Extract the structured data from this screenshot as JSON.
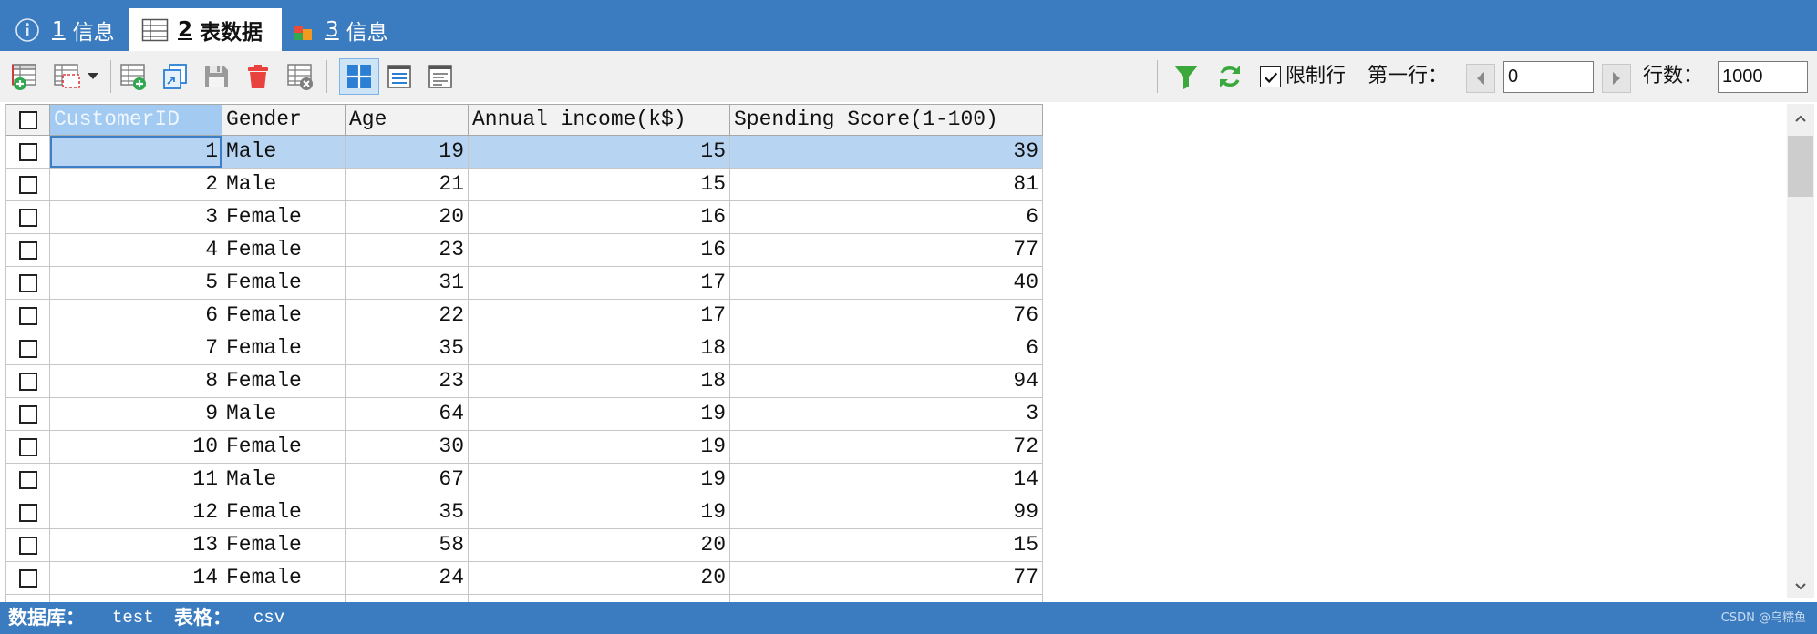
{
  "tabs": [
    {
      "number": "1",
      "label": "信息",
      "icon": "info-icon"
    },
    {
      "number": "2",
      "label": "表数据",
      "icon": "table-icon",
      "selected": true
    },
    {
      "number": "3",
      "label": "信息",
      "icon": "chart-icon"
    }
  ],
  "toolbar": {
    "buttons": [
      {
        "icon": "add-record-icon"
      },
      {
        "icon": "select-records-icon"
      },
      {
        "icon": "insert-record-icon"
      },
      {
        "icon": "duplicate-record-icon"
      },
      {
        "icon": "save-icon"
      },
      {
        "icon": "delete-icon"
      },
      {
        "icon": "cancel-changes-icon"
      },
      {
        "icon": "grid-view-icon",
        "active": true
      },
      {
        "icon": "form-view-icon"
      },
      {
        "icon": "text-view-icon"
      },
      {
        "icon": "filter-icon"
      },
      {
        "icon": "refresh-icon"
      }
    ],
    "limit_rows": {
      "label": "限制行",
      "checked": true
    },
    "first_row": {
      "label": "第一行：",
      "value": "0"
    },
    "row_count": {
      "label": "行数：",
      "value": "1000"
    }
  },
  "grid": {
    "columns": [
      "CustomerID",
      "Gender",
      "Age",
      "Annual income(k$)",
      "Spending Score(1-100)"
    ],
    "rows": [
      [
        1,
        "Male",
        19,
        15,
        39
      ],
      [
        2,
        "Male",
        21,
        15,
        81
      ],
      [
        3,
        "Female",
        20,
        16,
        6
      ],
      [
        4,
        "Female",
        23,
        16,
        77
      ],
      [
        5,
        "Female",
        31,
        17,
        40
      ],
      [
        6,
        "Female",
        22,
        17,
        76
      ],
      [
        7,
        "Female",
        35,
        18,
        6
      ],
      [
        8,
        "Female",
        23,
        18,
        94
      ],
      [
        9,
        "Male",
        64,
        19,
        3
      ],
      [
        10,
        "Female",
        30,
        19,
        72
      ],
      [
        11,
        "Male",
        67,
        19,
        14
      ],
      [
        12,
        "Female",
        35,
        19,
        99
      ],
      [
        13,
        "Female",
        58,
        20,
        15
      ],
      [
        14,
        "Female",
        24,
        20,
        77
      ]
    ],
    "focused_cell": {
      "row": 0,
      "column": 0
    }
  },
  "status_bar": {
    "database_label": "数据库：",
    "database_value": "test",
    "table_label": "表格：",
    "table_value": "csv"
  },
  "watermark": "CSDN @乌糯鱼",
  "colors": {
    "accent": "#3b7bbf",
    "selected_row": "#b7d5f3",
    "focused_cell_border": "#3c7fc6",
    "focused_column_header": "#a3cbf1"
  }
}
